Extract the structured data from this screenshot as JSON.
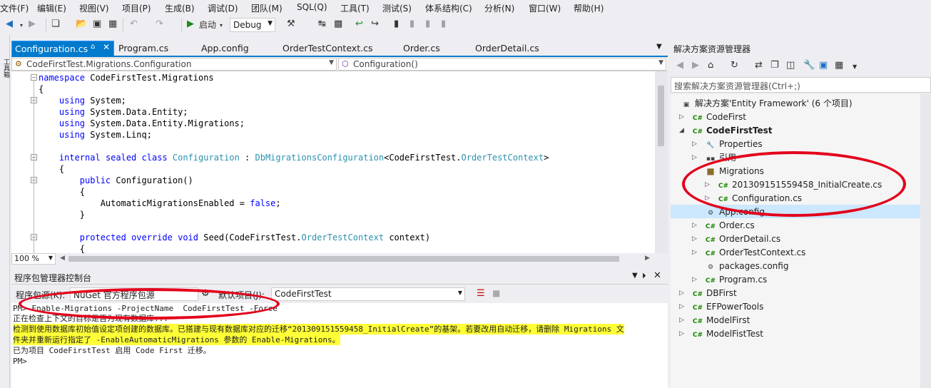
{
  "menu": {
    "items": [
      "文件(F)",
      "编辑(E)",
      "视图(V)",
      "项目(P)",
      "生成(B)",
      "调试(D)",
      "团队(M)",
      "SQL(Q)",
      "工具(T)",
      "测试(S)",
      "体系结构(C)",
      "分析(N)",
      "窗口(W)",
      "帮助(H)"
    ]
  },
  "toolbar": {
    "start_label": "启动",
    "config_value": "Debug"
  },
  "left_rail": {
    "label": "工具箱"
  },
  "editor": {
    "tabs": [
      {
        "label": "Configuration.cs",
        "active": true
      },
      {
        "label": "Program.cs"
      },
      {
        "label": "App.config"
      },
      {
        "label": "OrderTestContext.cs"
      },
      {
        "label": "Order.cs"
      },
      {
        "label": "OrderDetail.cs"
      }
    ],
    "nav_type": "CodeFirstTest.Migrations.Configuration",
    "nav_member": "Configuration()",
    "code_lines": [
      "namespace CodeFirstTest.Migrations",
      "{",
      "    using System;",
      "    using System.Data.Entity;",
      "    using System.Data.Entity.Migrations;",
      "    using System.Linq;",
      "",
      "    internal sealed class Configuration : DbMigrationsConfiguration<CodeFirstTest.OrderTestContext>",
      "    {",
      "        public Configuration()",
      "        {",
      "            AutomaticMigrationsEnabled = false;",
      "        }",
      "",
      "        protected override void Seed(CodeFirstTest.OrderTestContext context)",
      "        {"
    ],
    "zoom": "100 %"
  },
  "console": {
    "title": "程序包管理器控制台",
    "source_label": "程序包源(K):",
    "source_value": "NuGet 官方程序包源",
    "project_label": "默认项目(J):",
    "project_value": "CodeFirstTest",
    "lines": [
      {
        "text": "PM> Enable-Migrations -ProjectName  CodeFirstTest -Force",
        "hl": false
      },
      {
        "text": "正在检查上下文的目标是否为现有数据库...",
        "hl": false
      },
      {
        "text": "检测到使用数据库初始值设定项创建的数据库。已搭建与现有数据库对应的迁移“201309151559458_InitialCreate”的基架。若要改用自动迁移，请删除 Migrations 文",
        "hl": true
      },
      {
        "text": "件夹并重新运行指定了 -EnableAutomaticMigrations 参数的 Enable-Migrations。",
        "hl": true
      },
      {
        "text": "已为项目 CodeFirstTest 启用 Code First 迁移。",
        "hl": false
      },
      {
        "text": "PM>",
        "hl": false
      }
    ]
  },
  "solution_explorer": {
    "title": "解决方案资源管理器",
    "search_placeholder": "搜索解决方案资源管理器(Ctrl+;)",
    "solution": "解决方案'Entity Framework' (6 个项目)",
    "nodes": [
      {
        "label": "CodeFirst",
        "icon": "C#"
      },
      {
        "label": "CodeFirstTest",
        "icon": "C#"
      },
      {
        "label": "Properties",
        "icon": "wrench"
      },
      {
        "label": "引用",
        "icon": "ref"
      },
      {
        "label": "Migrations",
        "icon": "folder"
      },
      {
        "label": "201309151559458_InitialCreate.cs",
        "icon": "C#"
      },
      {
        "label": "Configuration.cs",
        "icon": "C#"
      },
      {
        "label": "App.config",
        "icon": "config"
      },
      {
        "label": "Order.cs",
        "icon": "C#"
      },
      {
        "label": "OrderDetail.cs",
        "icon": "C#"
      },
      {
        "label": "OrderTestContext.cs",
        "icon": "C#"
      },
      {
        "label": "packages.config",
        "icon": "config"
      },
      {
        "label": "Program.cs",
        "icon": "C#"
      },
      {
        "label": "DBFirst",
        "icon": "C#"
      },
      {
        "label": "EFPowerTools",
        "icon": "C#"
      },
      {
        "label": "ModelFirst",
        "icon": "C#"
      },
      {
        "label": "ModelFistTest",
        "icon": "C#"
      }
    ]
  },
  "colors": {
    "accent": "#007acc",
    "annotation": "#e3001b",
    "console_highlight": "#ffff38"
  }
}
